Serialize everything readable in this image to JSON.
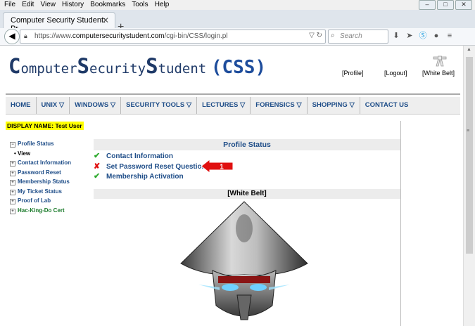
{
  "menubar": {
    "items": [
      "File",
      "Edit",
      "View",
      "History",
      "Bookmarks",
      "Tools",
      "Help"
    ]
  },
  "tab": {
    "title": "Computer Security Student: Pr..."
  },
  "address": {
    "prefix": "https://www.",
    "domain": "computersecuritystudent.com",
    "path": "/cgi-bin/CSS/login.pl"
  },
  "search": {
    "placeholder": "Search"
  },
  "site": {
    "logo": {
      "c": "C",
      "omputer": "omputer",
      "s": "S",
      "ecurity": "ecurity",
      "s2": "S",
      "tudent": "tudent",
      "css": "(CSS)"
    },
    "header_links": {
      "profile": "[Profile]",
      "logout": "[Logout]",
      "belt": "[White Belt]"
    },
    "nav": [
      "HOME",
      "UNIX ▽",
      "WINDOWS ▽",
      "SECURITY TOOLS ▽",
      "LECTURES ▽",
      "FORENSICS ▽",
      "SHOPPING ▽",
      "CONTACT US"
    ],
    "display_name": "DISPLAY NAME: Test User",
    "sidebar": [
      {
        "label": "Profile Status",
        "marker": "⊟"
      },
      {
        "label": "View",
        "marker": "•"
      },
      {
        "label": "Contact Information",
        "marker": "⊞"
      },
      {
        "label": "Password Reset",
        "marker": "⊞"
      },
      {
        "label": "Membership Status",
        "marker": "⊞"
      },
      {
        "label": "My Ticket Status",
        "marker": "⊞"
      },
      {
        "label": "Proof of Lab",
        "marker": "⊞"
      },
      {
        "label": "Hac-King-Do Cert",
        "marker": "⊞"
      }
    ],
    "profile_status": {
      "title": "Profile Status",
      "items": [
        {
          "label": "Contact Information",
          "status": "ok",
          "icon": "✔"
        },
        {
          "label": "Set Password Reset Question",
          "status": "missing",
          "icon": "✘"
        },
        {
          "label": "Membership Activation",
          "status": "ok",
          "icon": "✔"
        }
      ]
    },
    "callout_number": "1",
    "belt_title": "[White Belt]"
  },
  "colors": {
    "accent": "#1e4d88",
    "ok": "#2eaa2e",
    "error": "#e01010",
    "callout": "#e01010",
    "highlight": "#ffff00"
  }
}
